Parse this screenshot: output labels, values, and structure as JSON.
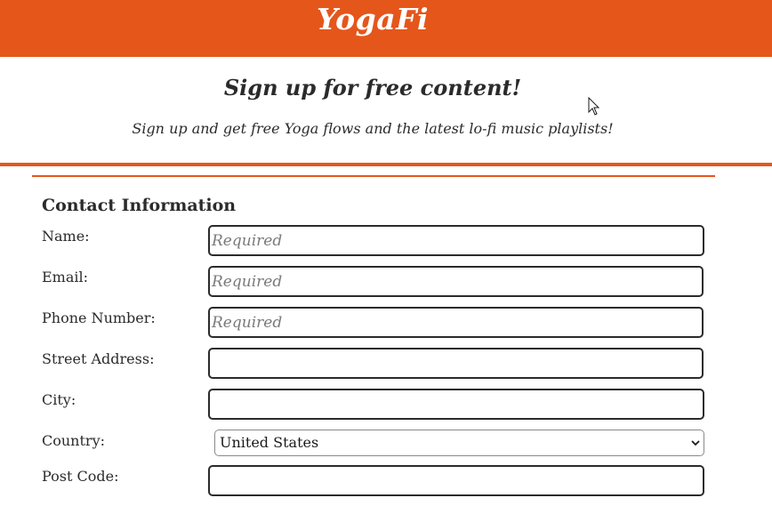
{
  "header": {
    "brand": "YogaFi"
  },
  "hero": {
    "title": "Sign up for free content!",
    "subtitle": "Sign up and get free Yoga flows and the latest lo-fi music playlists!"
  },
  "form": {
    "section_title": "Contact Information",
    "fields": [
      {
        "label": "Name:",
        "placeholder": "Required",
        "value": ""
      },
      {
        "label": "Email:",
        "placeholder": "Required",
        "value": ""
      },
      {
        "label": "Phone Number:",
        "placeholder": "Required",
        "value": ""
      },
      {
        "label": "Street Address:",
        "placeholder": "",
        "value": ""
      },
      {
        "label": "City:",
        "placeholder": "",
        "value": ""
      },
      {
        "label": "Country:",
        "selected": "United States"
      },
      {
        "label": "Post Code:",
        "placeholder": "",
        "value": ""
      }
    ]
  },
  "colors": {
    "accent": "#e5561b",
    "text": "#2b2b2b",
    "background": "#ffffff"
  },
  "icons": {
    "dropdown": "chevron-down-icon",
    "cursor": "mouse-pointer-icon"
  }
}
